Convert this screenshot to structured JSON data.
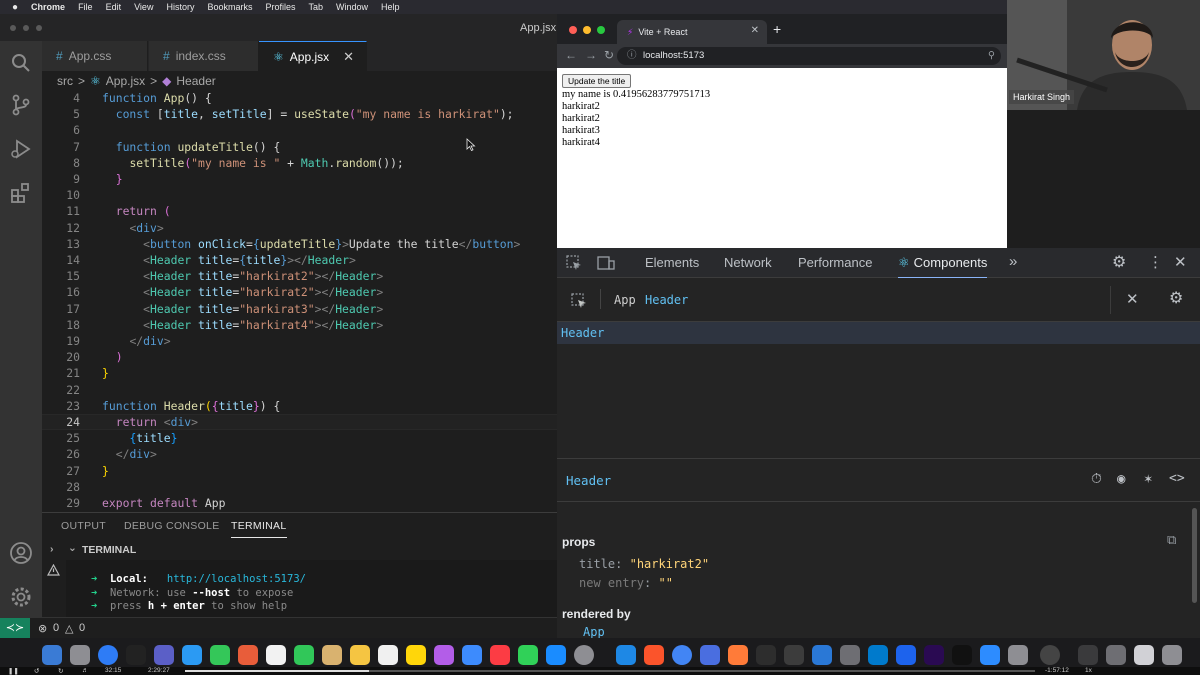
{
  "menubar": {
    "apple": "",
    "items": [
      "Chrome",
      "File",
      "Edit",
      "View",
      "History",
      "Bookmarks",
      "Profiles",
      "Tab",
      "Window",
      "Help"
    ]
  },
  "vscode": {
    "window_title": "App.jsx",
    "tabs": [
      {
        "label": "App.css",
        "icon": "css-hash-icon"
      },
      {
        "label": "index.css",
        "icon": "css-hash-icon"
      },
      {
        "label": "App.jsx",
        "icon": "react-icon",
        "active": true
      }
    ],
    "breadcrumb": {
      "folder": "src",
      "sep": ">",
      "file": "App.jsx",
      "symbol": "Header"
    },
    "cursor_line": 24,
    "code_lines": [
      {
        "n": "4"
      },
      {
        "n": "5"
      },
      {
        "n": "6"
      },
      {
        "n": "7"
      },
      {
        "n": "8"
      },
      {
        "n": "9"
      },
      {
        "n": "10"
      },
      {
        "n": "11"
      },
      {
        "n": "12"
      },
      {
        "n": "13"
      },
      {
        "n": "14"
      },
      {
        "n": "15"
      },
      {
        "n": "16"
      },
      {
        "n": "17"
      },
      {
        "n": "18"
      },
      {
        "n": "19"
      },
      {
        "n": "20"
      },
      {
        "n": "21"
      },
      {
        "n": "22"
      },
      {
        "n": "23"
      },
      {
        "n": "24"
      },
      {
        "n": "25"
      },
      {
        "n": "26"
      },
      {
        "n": "27"
      },
      {
        "n": "28"
      },
      {
        "n": "29"
      }
    ],
    "code": {
      "l4": [
        "function",
        " ",
        "App",
        "() {"
      ],
      "l5": [
        "const",
        " [",
        "title",
        ", ",
        "setTitle",
        "] = ",
        "useState",
        "(",
        "\"my name is harkirat\"",
        ");"
      ],
      "l7": [
        "function",
        " ",
        "updateTitle",
        "() {"
      ],
      "l8": [
        "setTitle",
        "(",
        "\"my name is \"",
        " + ",
        "Math",
        ".",
        "random",
        "());"
      ],
      "l9": [
        "}"
      ],
      "l11": [
        "return",
        " ("
      ],
      "l12": [
        "<",
        "div",
        ">"
      ],
      "l13": [
        "<",
        "button",
        " ",
        "onClick",
        "=",
        "{",
        "updateTitle",
        "}",
        ">",
        "Update the title",
        "</",
        "button",
        ">"
      ],
      "l14": [
        "<",
        "Header",
        " ",
        "title",
        "=",
        "{",
        "title",
        "}",
        "></",
        "Header",
        ">"
      ],
      "l15": [
        "<",
        "Header",
        " ",
        "title",
        "=",
        "\"harkirat2\"",
        "></",
        "Header",
        ">"
      ],
      "l16": [
        "<",
        "Header",
        " ",
        "title",
        "=",
        "\"harkirat2\"",
        "></",
        "Header",
        ">"
      ],
      "l17": [
        "<",
        "Header",
        " ",
        "title",
        "=",
        "\"harkirat3\"",
        "></",
        "Header",
        ">"
      ],
      "l18": [
        "<",
        "Header",
        " ",
        "title",
        "=",
        "\"harkirat4\"",
        "></",
        "Header",
        ">"
      ],
      "l19": [
        "</",
        "div",
        ">"
      ],
      "l20": [
        ")"
      ],
      "l21": [
        "}"
      ],
      "l23": [
        "function",
        " ",
        "Header",
        "(",
        "{",
        "title",
        "}",
        ") {"
      ],
      "l24": [
        "return",
        " <",
        "div",
        ">"
      ],
      "l25": [
        "{",
        "title",
        "}"
      ],
      "l26": [
        "</",
        "div",
        ">"
      ],
      "l27": [
        "}"
      ],
      "l29": [
        "export",
        " ",
        "default",
        " App"
      ]
    },
    "panel_tabs": [
      "OUTPUT",
      "DEBUG CONSOLE",
      "TERMINAL"
    ],
    "terminal_header": "TERMINAL",
    "terminal": {
      "arrow": "➜",
      "local_label": "Local:",
      "local_url": "http://localhost:5173/",
      "network_label": "Network:",
      "network_text_1": "use",
      "network_flag": "--host",
      "network_text_2": "to expose",
      "help_1": "press",
      "help_key": "h + enter",
      "help_2": "to show help"
    },
    "status": {
      "errors": "0",
      "warnings": "0"
    }
  },
  "chrome": {
    "tab_title": "Vite + React",
    "new_tab": "+",
    "url": "localhost:5173",
    "page": {
      "button": "Update the title",
      "lines": [
        "my name is 0.41956283779751713",
        "harkirat2",
        "harkirat2",
        "harkirat3",
        "harkirat4"
      ]
    }
  },
  "webcam": {
    "name": "Harkirat Singh"
  },
  "devtools": {
    "tabs": [
      "Elements",
      "Network",
      "Performance",
      "Components"
    ],
    "more": "»",
    "breadcrumb": [
      "App",
      "Header"
    ],
    "tree_selected": "Header",
    "selected_component": "Header",
    "props_label": "props",
    "props": [
      {
        "key": "title",
        "value": "\"harkirat2\""
      },
      {
        "key": "new entry",
        "value": "\"\""
      }
    ],
    "rendered_by_label": "rendered by",
    "rendered_by": "App"
  },
  "video": {
    "elapsed": "32:15",
    "total": "2:29:27",
    "remaining": "-1:57:12",
    "speed": "1x"
  },
  "colors": {
    "vscode_bg": "#1e1e1e",
    "accent": "#3794ff",
    "react": "#61dafb",
    "devtools_bg": "#242424"
  }
}
